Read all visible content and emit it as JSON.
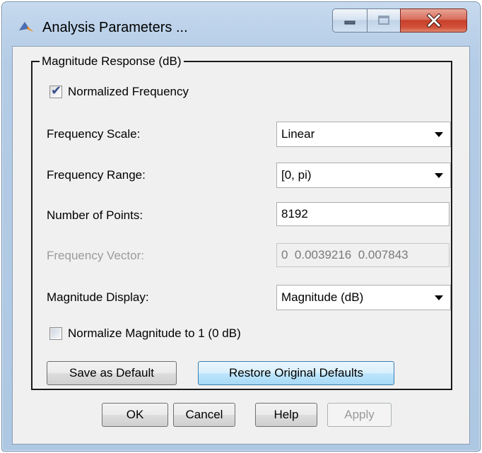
{
  "window": {
    "title": "Analysis Parameters ...",
    "app_icon": "matlab-icon",
    "caption_buttons": [
      "minimize-icon",
      "maximize-icon",
      "close-icon"
    ]
  },
  "group": {
    "legend": "Magnitude Response (dB)",
    "normalized_frequency": {
      "label": "Normalized Frequency",
      "checked": true
    },
    "frequency_scale": {
      "label": "Frequency Scale:",
      "value": "Linear"
    },
    "frequency_range": {
      "label": "Frequency Range:",
      "value": "[0, pi)"
    },
    "number_of_points": {
      "label": "Number of Points:",
      "value": "8192"
    },
    "frequency_vector": {
      "label": "Frequency Vector:",
      "value": "0  0.0039216  0.007843"
    },
    "magnitude_display": {
      "label": "Magnitude Display:",
      "value": "Magnitude (dB)"
    },
    "normalize_magnitude": {
      "label": "Normalize Magnitude to 1 (0 dB)",
      "checked": false
    },
    "save_default_label": "Save as Default",
    "restore_defaults_label": "Restore Original Defaults"
  },
  "footer": {
    "ok_label": "OK",
    "cancel_label": "Cancel",
    "help_label": "Help",
    "apply_label": "Apply"
  },
  "colors": {
    "frame": "#b4cce6",
    "close_button": "#c7402a",
    "dialog_background": "#f0f0f0",
    "disabled_text": "#9b9b9b"
  }
}
